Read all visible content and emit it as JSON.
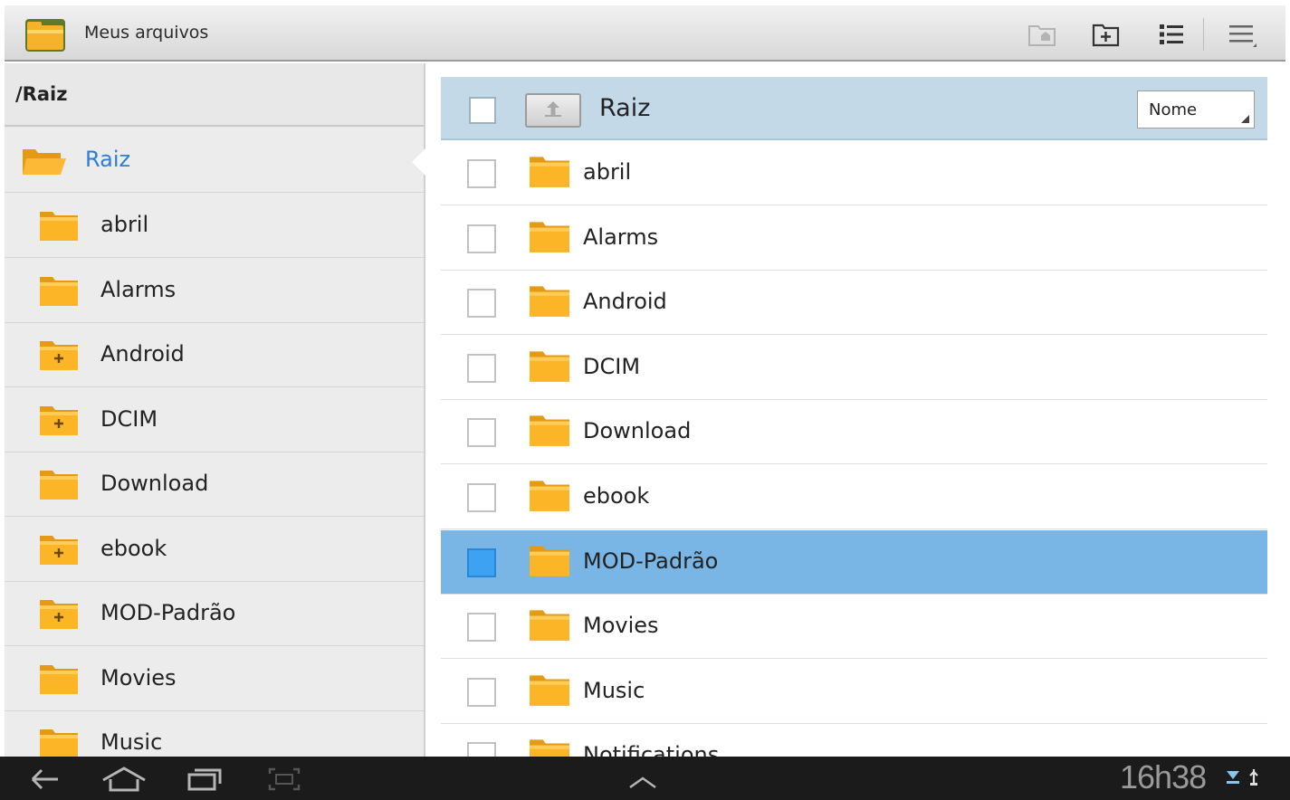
{
  "action_bar": {
    "title": "Meus arquivos",
    "icons": [
      "app-folder-icon",
      "home-folder-icon",
      "new-folder-icon",
      "list-view-icon",
      "menu-icon"
    ]
  },
  "left_panel": {
    "path": "/Raiz",
    "root_label": "Raiz",
    "items": [
      {
        "label": "abril",
        "has_children": false
      },
      {
        "label": "Alarms",
        "has_children": false
      },
      {
        "label": "Android",
        "has_children": true
      },
      {
        "label": "DCIM",
        "has_children": true
      },
      {
        "label": "Download",
        "has_children": false
      },
      {
        "label": "ebook",
        "has_children": true
      },
      {
        "label": "MOD-Padrão",
        "has_children": true
      },
      {
        "label": "Movies",
        "has_children": false
      },
      {
        "label": "Music",
        "has_children": false
      }
    ]
  },
  "right_panel": {
    "header_title": "Raiz",
    "sort_label": "Nome",
    "files": [
      {
        "label": "abril",
        "selected": false
      },
      {
        "label": "Alarms",
        "selected": false
      },
      {
        "label": "Android",
        "selected": false
      },
      {
        "label": "DCIM",
        "selected": false
      },
      {
        "label": "Download",
        "selected": false
      },
      {
        "label": "ebook",
        "selected": false
      },
      {
        "label": "MOD-Padrão",
        "selected": true
      },
      {
        "label": "Movies",
        "selected": false
      },
      {
        "label": "Music",
        "selected": false
      },
      {
        "label": "Notifications",
        "selected": false
      }
    ]
  },
  "nav_bar": {
    "time": "16h38",
    "icons": [
      "back-icon",
      "home-icon",
      "recent-apps-icon",
      "screenshot-icon",
      "expand-up-icon",
      "download-status-icon",
      "usb-status-icon"
    ]
  },
  "colors": {
    "accent": "#2c7fd4",
    "header_bg": "#c3d9e7",
    "selected_row": "#79b5e5",
    "folder": "#f9b42b"
  }
}
